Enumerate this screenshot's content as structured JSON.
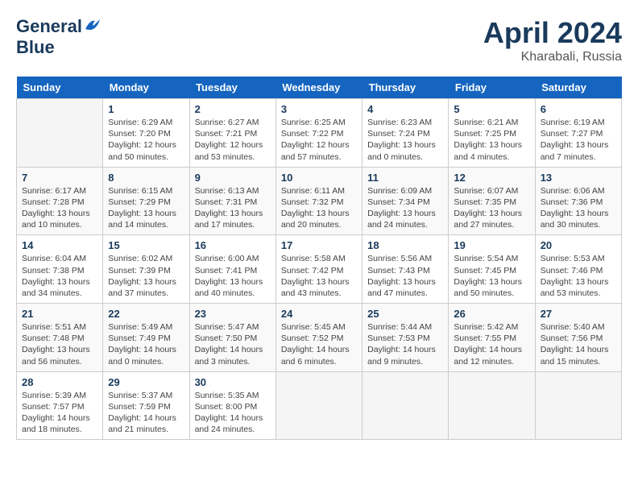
{
  "logo": {
    "general": "General",
    "blue": "Blue"
  },
  "header": {
    "month": "April 2024",
    "location": "Kharabali, Russia"
  },
  "days_of_week": [
    "Sunday",
    "Monday",
    "Tuesday",
    "Wednesday",
    "Thursday",
    "Friday",
    "Saturday"
  ],
  "weeks": [
    [
      {
        "day": "",
        "info": ""
      },
      {
        "day": "1",
        "info": "Sunrise: 6:29 AM\nSunset: 7:20 PM\nDaylight: 12 hours\nand 50 minutes."
      },
      {
        "day": "2",
        "info": "Sunrise: 6:27 AM\nSunset: 7:21 PM\nDaylight: 12 hours\nand 53 minutes."
      },
      {
        "day": "3",
        "info": "Sunrise: 6:25 AM\nSunset: 7:22 PM\nDaylight: 12 hours\nand 57 minutes."
      },
      {
        "day": "4",
        "info": "Sunrise: 6:23 AM\nSunset: 7:24 PM\nDaylight: 13 hours\nand 0 minutes."
      },
      {
        "day": "5",
        "info": "Sunrise: 6:21 AM\nSunset: 7:25 PM\nDaylight: 13 hours\nand 4 minutes."
      },
      {
        "day": "6",
        "info": "Sunrise: 6:19 AM\nSunset: 7:27 PM\nDaylight: 13 hours\nand 7 minutes."
      }
    ],
    [
      {
        "day": "7",
        "info": "Sunrise: 6:17 AM\nSunset: 7:28 PM\nDaylight: 13 hours\nand 10 minutes."
      },
      {
        "day": "8",
        "info": "Sunrise: 6:15 AM\nSunset: 7:29 PM\nDaylight: 13 hours\nand 14 minutes."
      },
      {
        "day": "9",
        "info": "Sunrise: 6:13 AM\nSunset: 7:31 PM\nDaylight: 13 hours\nand 17 minutes."
      },
      {
        "day": "10",
        "info": "Sunrise: 6:11 AM\nSunset: 7:32 PM\nDaylight: 13 hours\nand 20 minutes."
      },
      {
        "day": "11",
        "info": "Sunrise: 6:09 AM\nSunset: 7:34 PM\nDaylight: 13 hours\nand 24 minutes."
      },
      {
        "day": "12",
        "info": "Sunrise: 6:07 AM\nSunset: 7:35 PM\nDaylight: 13 hours\nand 27 minutes."
      },
      {
        "day": "13",
        "info": "Sunrise: 6:06 AM\nSunset: 7:36 PM\nDaylight: 13 hours\nand 30 minutes."
      }
    ],
    [
      {
        "day": "14",
        "info": "Sunrise: 6:04 AM\nSunset: 7:38 PM\nDaylight: 13 hours\nand 34 minutes."
      },
      {
        "day": "15",
        "info": "Sunrise: 6:02 AM\nSunset: 7:39 PM\nDaylight: 13 hours\nand 37 minutes."
      },
      {
        "day": "16",
        "info": "Sunrise: 6:00 AM\nSunset: 7:41 PM\nDaylight: 13 hours\nand 40 minutes."
      },
      {
        "day": "17",
        "info": "Sunrise: 5:58 AM\nSunset: 7:42 PM\nDaylight: 13 hours\nand 43 minutes."
      },
      {
        "day": "18",
        "info": "Sunrise: 5:56 AM\nSunset: 7:43 PM\nDaylight: 13 hours\nand 47 minutes."
      },
      {
        "day": "19",
        "info": "Sunrise: 5:54 AM\nSunset: 7:45 PM\nDaylight: 13 hours\nand 50 minutes."
      },
      {
        "day": "20",
        "info": "Sunrise: 5:53 AM\nSunset: 7:46 PM\nDaylight: 13 hours\nand 53 minutes."
      }
    ],
    [
      {
        "day": "21",
        "info": "Sunrise: 5:51 AM\nSunset: 7:48 PM\nDaylight: 13 hours\nand 56 minutes."
      },
      {
        "day": "22",
        "info": "Sunrise: 5:49 AM\nSunset: 7:49 PM\nDaylight: 14 hours\nand 0 minutes."
      },
      {
        "day": "23",
        "info": "Sunrise: 5:47 AM\nSunset: 7:50 PM\nDaylight: 14 hours\nand 3 minutes."
      },
      {
        "day": "24",
        "info": "Sunrise: 5:45 AM\nSunset: 7:52 PM\nDaylight: 14 hours\nand 6 minutes."
      },
      {
        "day": "25",
        "info": "Sunrise: 5:44 AM\nSunset: 7:53 PM\nDaylight: 14 hours\nand 9 minutes."
      },
      {
        "day": "26",
        "info": "Sunrise: 5:42 AM\nSunset: 7:55 PM\nDaylight: 14 hours\nand 12 minutes."
      },
      {
        "day": "27",
        "info": "Sunrise: 5:40 AM\nSunset: 7:56 PM\nDaylight: 14 hours\nand 15 minutes."
      }
    ],
    [
      {
        "day": "28",
        "info": "Sunrise: 5:39 AM\nSunset: 7:57 PM\nDaylight: 14 hours\nand 18 minutes."
      },
      {
        "day": "29",
        "info": "Sunrise: 5:37 AM\nSunset: 7:59 PM\nDaylight: 14 hours\nand 21 minutes."
      },
      {
        "day": "30",
        "info": "Sunrise: 5:35 AM\nSunset: 8:00 PM\nDaylight: 14 hours\nand 24 minutes."
      },
      {
        "day": "",
        "info": ""
      },
      {
        "day": "",
        "info": ""
      },
      {
        "day": "",
        "info": ""
      },
      {
        "day": "",
        "info": ""
      }
    ]
  ]
}
